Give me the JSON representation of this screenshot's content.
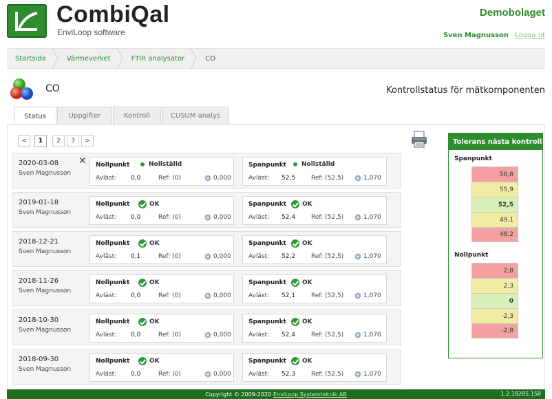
{
  "header": {
    "brand": "CombiQal",
    "brand_sub": "EnviLoop software",
    "company": "Demobolaget",
    "user": "Sven Magnusson",
    "logout": "Logga ut"
  },
  "breadcrumb": [
    {
      "label": "Startsida"
    },
    {
      "label": "Värmeverket"
    },
    {
      "label": "FTIR analysator"
    },
    {
      "label": "CO"
    }
  ],
  "page": {
    "title": "CO",
    "subtitle": "Kontrollstatus för mätkomponenten"
  },
  "tabs": [
    {
      "label": "Status"
    },
    {
      "label": "Uppgifter"
    },
    {
      "label": "Kontroll"
    },
    {
      "label": "CUSUM analys"
    }
  ],
  "pager": {
    "prev": "<",
    "pages": [
      "1",
      "2",
      "3"
    ],
    "next": ">"
  },
  "labels": {
    "zero": "Nollpunkt",
    "span": "Spanpunkt",
    "read": "Avläst:"
  },
  "records": [
    {
      "date": "2020-03-08",
      "user": "Sven Magnusson",
      "deletable": true,
      "zero": {
        "status": "Nollställd",
        "value": "0,0",
        "ref": "Ref: (0)",
        "dev": "0,000"
      },
      "span": {
        "status": "Nollställd",
        "value": "52,5",
        "ref": "Ref: (52,5)",
        "dev": "1,070"
      }
    },
    {
      "date": "2019-01-18",
      "user": "Sven Magnusson",
      "zero": {
        "status": "OK",
        "value": "0,0",
        "ref": "Ref: (0)",
        "dev": "0,000"
      },
      "span": {
        "status": "OK",
        "value": "52,4",
        "ref": "Ref: (52,5)",
        "dev": "1,070"
      }
    },
    {
      "date": "2018-12-21",
      "user": "Sven Magnusson",
      "zero": {
        "status": "OK",
        "value": "0,1",
        "ref": "Ref: (0)",
        "dev": "0,000"
      },
      "span": {
        "status": "OK",
        "value": "52,2",
        "ref": "Ref: (52,5)",
        "dev": "1,070"
      }
    },
    {
      "date": "2018-11-26",
      "user": "Sven Magnusson",
      "zero": {
        "status": "OK",
        "value": "0,0",
        "ref": "Ref: (0)",
        "dev": "0,000"
      },
      "span": {
        "status": "OK",
        "value": "52,1",
        "ref": "Ref: (52,5)",
        "dev": "1,070"
      }
    },
    {
      "date": "2018-10-30",
      "user": "Sven Magnusson",
      "zero": {
        "status": "OK",
        "value": "0,0",
        "ref": "Ref: (0)",
        "dev": "0,000"
      },
      "span": {
        "status": "OK",
        "value": "52,4",
        "ref": "Ref: (52,5)",
        "dev": "1,070"
      }
    },
    {
      "date": "2018-09-30",
      "user": "Sven Magnusson",
      "zero": {
        "status": "OK",
        "value": "0,0",
        "ref": "Ref: (0)",
        "dev": "0,000"
      },
      "span": {
        "status": "OK",
        "value": "52,3",
        "ref": "Ref: (52,5)",
        "dev": "1,070"
      }
    }
  ],
  "tolerance": {
    "title": "Tolerans nästa kontroll",
    "span_label": "Spanpunkt",
    "span_values": [
      {
        "v": "56,8",
        "level": "red"
      },
      {
        "v": "55,9",
        "level": "yellow"
      },
      {
        "v": "52,5",
        "level": "green"
      },
      {
        "v": "49,1",
        "level": "yellow"
      },
      {
        "v": "48,2",
        "level": "red"
      }
    ],
    "zero_label": "Nollpunkt",
    "zero_values": [
      {
        "v": "2,8",
        "level": "red"
      },
      {
        "v": "2,3",
        "level": "yellow"
      },
      {
        "v": "0",
        "level": "green"
      },
      {
        "v": "-2,3",
        "level": "yellow"
      },
      {
        "v": "-2,8",
        "level": "red"
      }
    ]
  },
  "colors": {
    "brand": "#2e8b2e",
    "red": "#f2a0a0",
    "yellow": "#f0eca2",
    "green": "#d9efb8"
  },
  "footer": {
    "copyright": "Copyright © 2009-2020",
    "link": "EnviLoop Systemteknik AB",
    "version": "1.2.18285.158"
  }
}
